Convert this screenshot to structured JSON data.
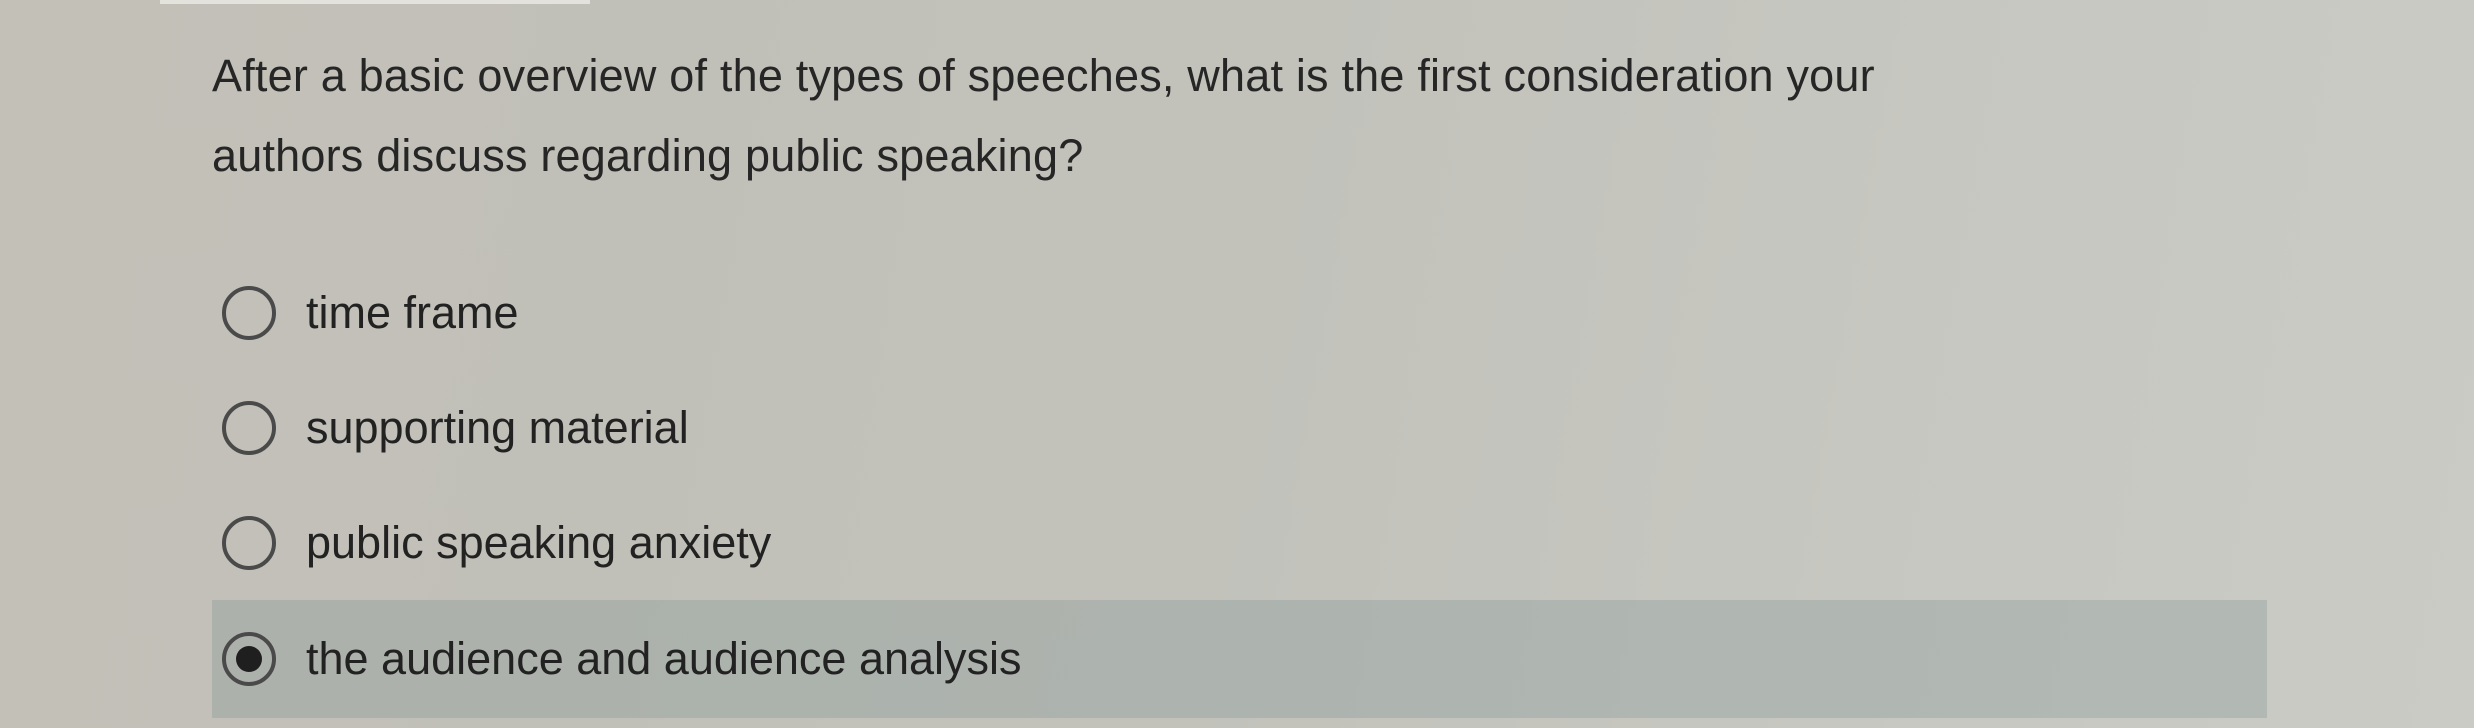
{
  "question": {
    "line1": "After a basic overview of the types of speeches, what is the first consideration your",
    "line2": "authors discuss regarding public speaking?"
  },
  "options": [
    {
      "label": "time frame",
      "selected": false
    },
    {
      "label": "supporting material",
      "selected": false
    },
    {
      "label": "public speaking anxiety",
      "selected": false
    },
    {
      "label": "the audience and audience analysis",
      "selected": true
    }
  ],
  "colors": {
    "selected_highlight": "#9aa8a6",
    "radio_border": "#4a4a4a",
    "text": "#262626"
  }
}
